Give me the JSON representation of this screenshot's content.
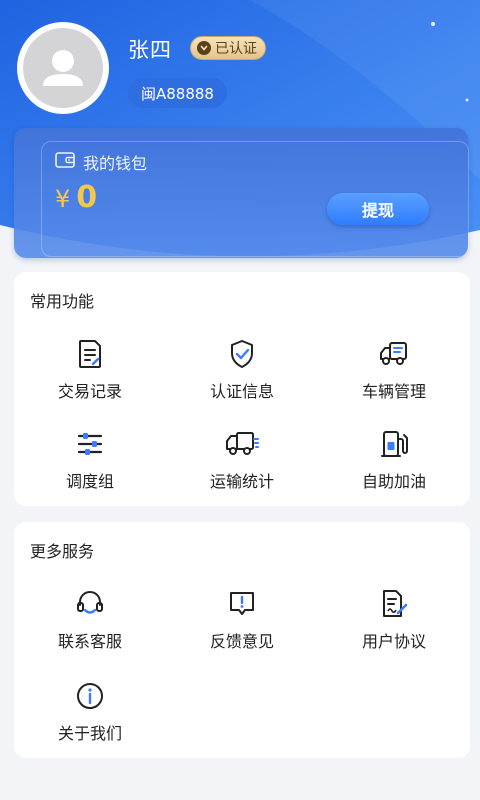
{
  "profile": {
    "name": "张四",
    "verified_label": "已认证",
    "plate": "闽A88888"
  },
  "wallet": {
    "title": "我的钱包",
    "currency": "¥",
    "balance": "0",
    "withdraw_label": "提现"
  },
  "common_functions": {
    "title": "常用功能",
    "items": [
      {
        "label": "交易记录",
        "icon": "document-icon"
      },
      {
        "label": "认证信息",
        "icon": "shield-check-icon"
      },
      {
        "label": "车辆管理",
        "icon": "truck-doc-icon"
      },
      {
        "label": "调度组",
        "icon": "sliders-icon"
      },
      {
        "label": "运输统计",
        "icon": "truck-icon"
      },
      {
        "label": "自助加油",
        "icon": "fuel-pump-icon"
      }
    ]
  },
  "more_services": {
    "title": "更多服务",
    "items": [
      {
        "label": "联系客服",
        "icon": "headset-icon"
      },
      {
        "label": "反馈意见",
        "icon": "feedback-icon"
      },
      {
        "label": "用户协议",
        "icon": "agreement-icon"
      },
      {
        "label": "关于我们",
        "icon": "info-icon"
      }
    ]
  },
  "colors": {
    "primary": "#2f6ee0",
    "accent": "#3a7bff",
    "gold": "#f6c84a"
  }
}
